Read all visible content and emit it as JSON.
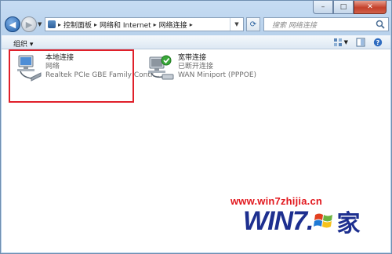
{
  "window": {
    "caption_buttons": {
      "minimize": "–",
      "maximize": "□",
      "close": "✕"
    }
  },
  "nav": {
    "back_icon": "arrow-left-icon",
    "forward_icon": "arrow-right-icon",
    "breadcrumbs": [
      "控制面板",
      "网络和 Internet",
      "网络连接"
    ],
    "search_placeholder": "搜索 网络连接"
  },
  "toolbar": {
    "organize_label": "组织 ▾"
  },
  "connections": [
    {
      "name": "本地连接",
      "status": "网络",
      "device": "Realtek PCIe GBE Family Contr..."
    },
    {
      "name": "宽带连接",
      "status": "已断开连接",
      "device": "WAN Miniport (PPPOE)"
    }
  ],
  "watermark": {
    "url": "www.win7zhijia.cn",
    "logo_win": "WIN",
    "logo_seven": "7.",
    "logo_jia": "家"
  },
  "colors": {
    "highlight_box": "#e0202a",
    "watermark_url": "#e2181e",
    "logo": "#1d2f8f"
  }
}
